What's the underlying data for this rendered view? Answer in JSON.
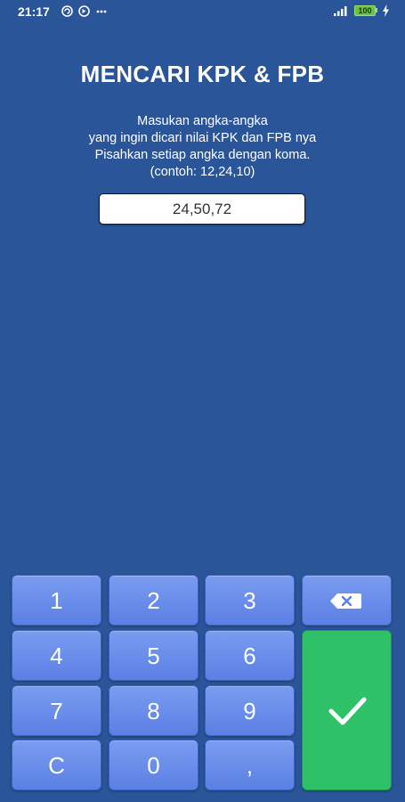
{
  "status_bar": {
    "time": "21:17",
    "battery": "100"
  },
  "header": {
    "title": "MENCARI KPK & FPB"
  },
  "instructions": {
    "line1": "Masukan angka-angka",
    "line2": "yang ingin dicari nilai KPK dan FPB nya",
    "line3": "Pisahkan setiap angka dengan koma.",
    "line4": "(contoh: 12,24,10)"
  },
  "input": {
    "value": "24,50,72"
  },
  "keypad": {
    "k1": "1",
    "k2": "2",
    "k3": "3",
    "k4": "4",
    "k5": "5",
    "k6": "6",
    "k7": "7",
    "k8": "8",
    "k9": "9",
    "clear": "C",
    "k0": "0",
    "comma": ",",
    "backspace_icon": "backspace-icon",
    "submit_icon": "checkmark-icon",
    "key_color": "#6a8ff0",
    "submit_color": "#2fc168"
  },
  "theme": {
    "background": "#2a5599"
  }
}
